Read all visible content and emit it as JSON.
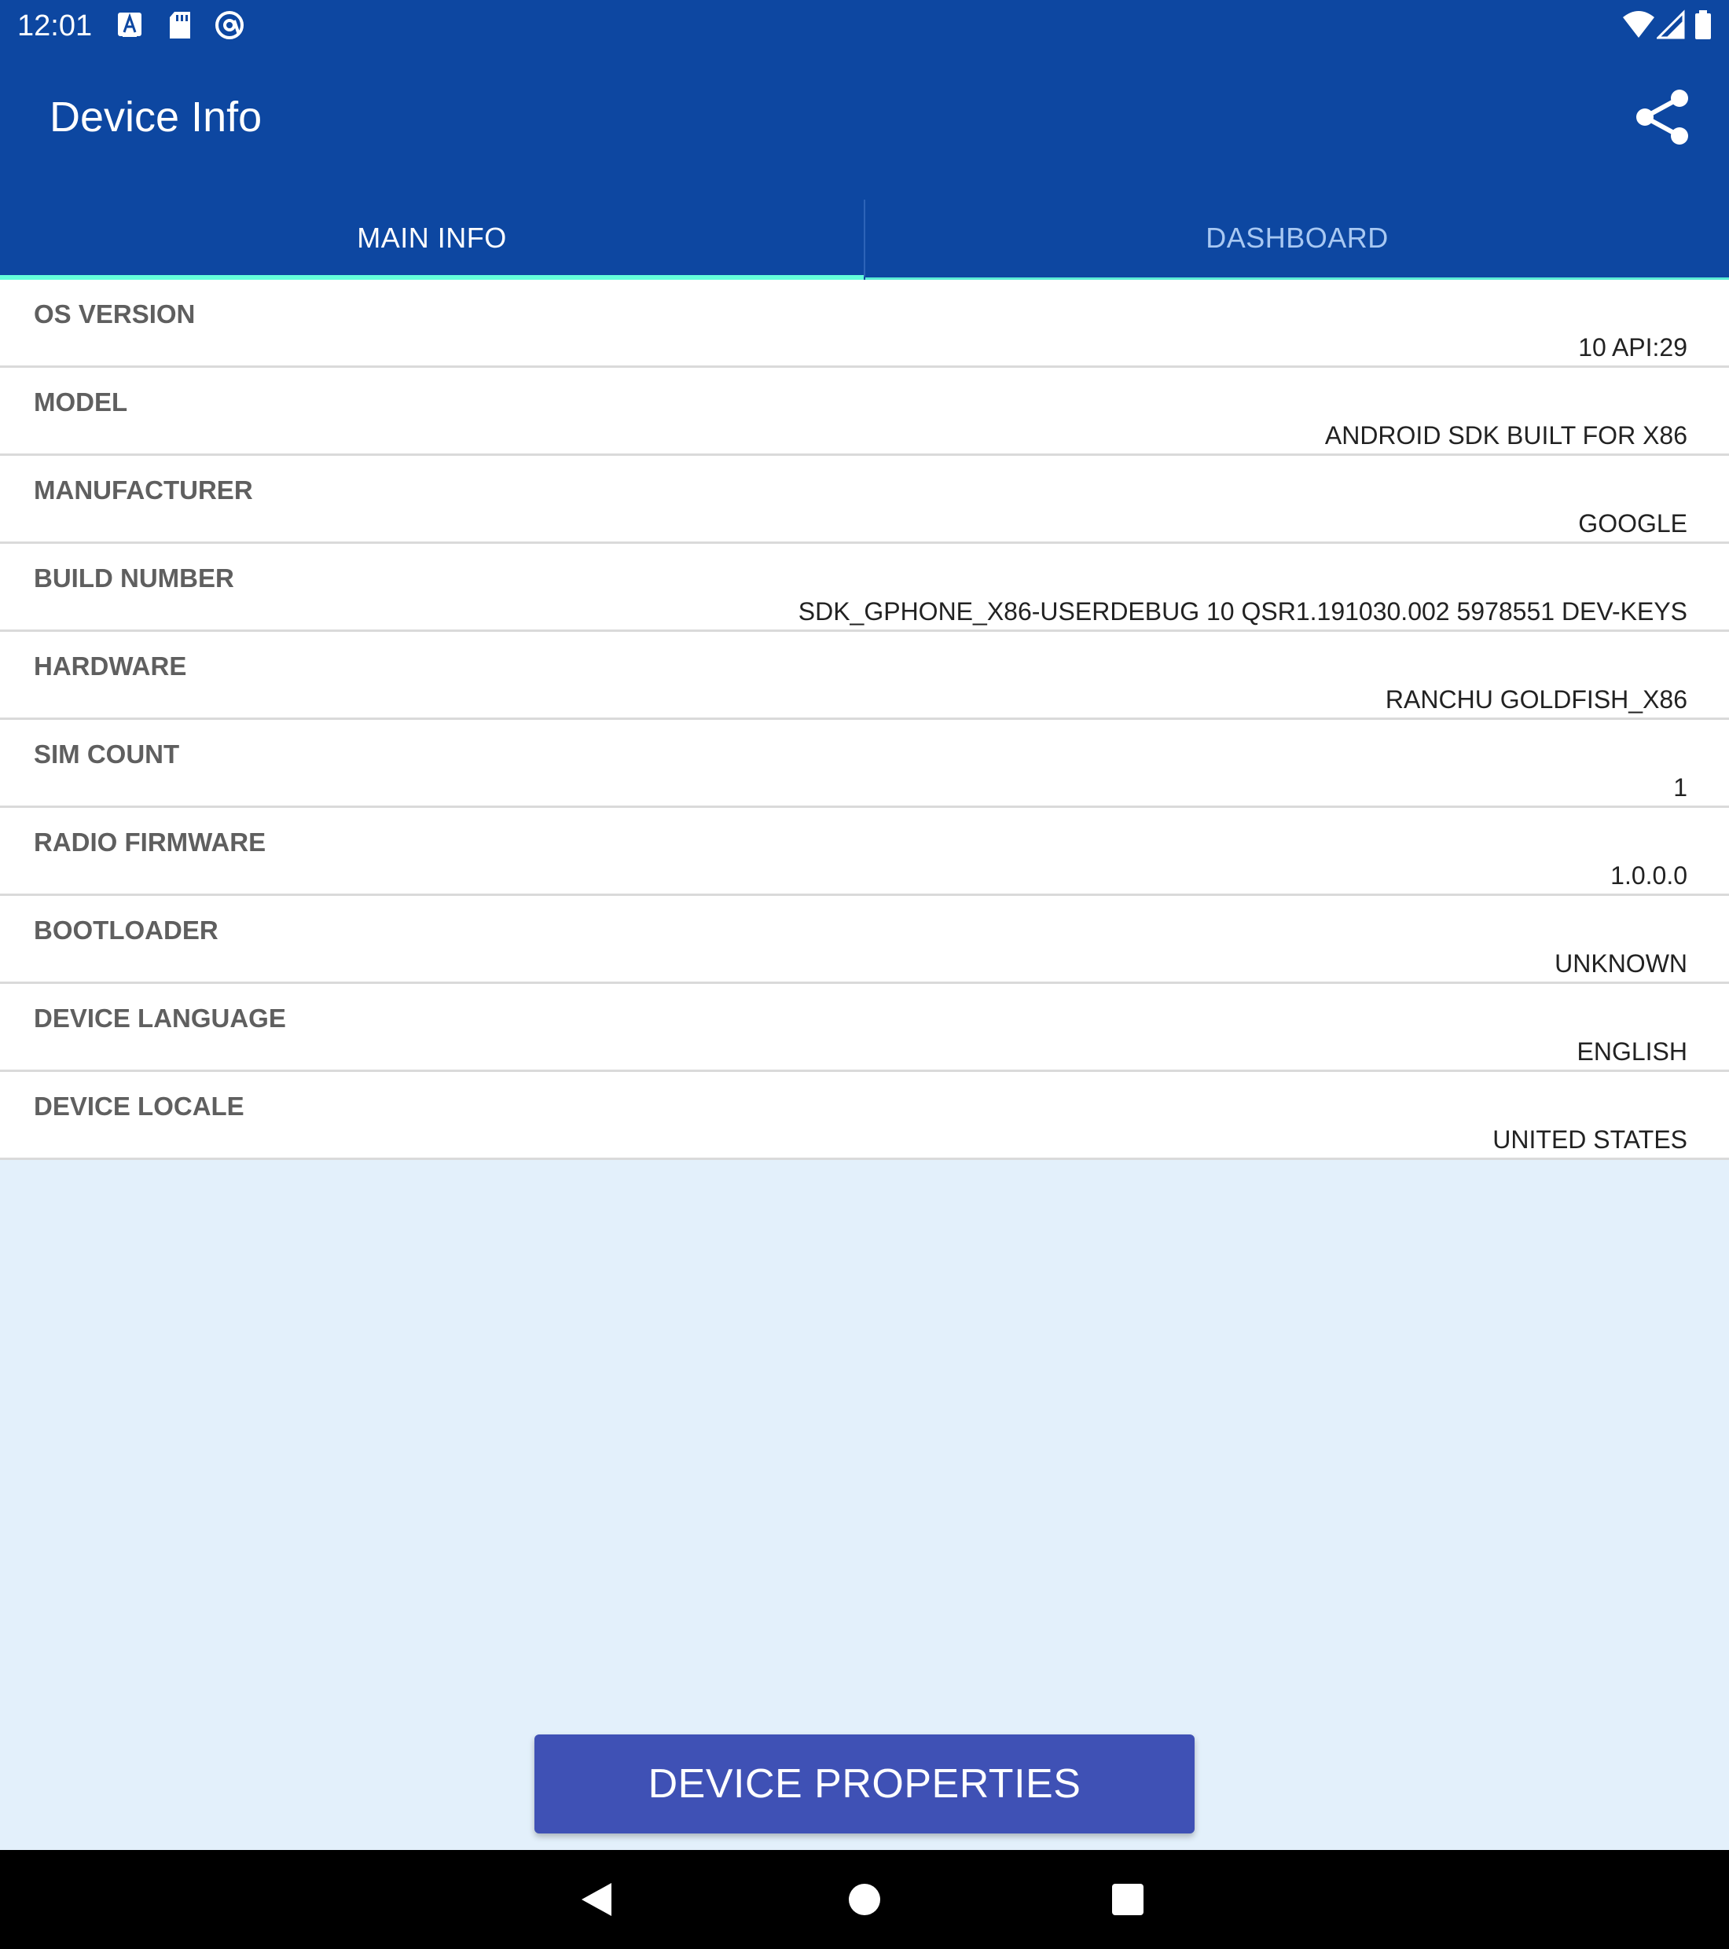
{
  "status_bar": {
    "time": "12:01",
    "left_icons": [
      "text-notification-icon",
      "sd-card-icon",
      "accessibility-icon"
    ],
    "right_icons": [
      "wifi-icon",
      "signal-icon",
      "battery-icon"
    ]
  },
  "app_bar": {
    "title": "Device Info",
    "share_icon": "share-icon"
  },
  "tabs": [
    {
      "label": "MAIN INFO",
      "selected": true
    },
    {
      "label": "DASHBOARD",
      "selected": false
    }
  ],
  "colors": {
    "primary": "#0d47a1",
    "tab_indicator": "#64ffda",
    "button": "#3f51b5",
    "background": "#e3f0fb"
  },
  "info": [
    {
      "label": "OS VERSION",
      "value": "10  API:29"
    },
    {
      "label": "MODEL",
      "value": "ANDROID SDK BUILT FOR X86"
    },
    {
      "label": "MANUFACTURER",
      "value": "GOOGLE"
    },
    {
      "label": "BUILD NUMBER",
      "value": "SDK_GPHONE_X86-USERDEBUG 10 QSR1.191030.002 5978551 DEV-KEYS"
    },
    {
      "label": "HARDWARE",
      "value": "RANCHU GOLDFISH_X86"
    },
    {
      "label": "SIM COUNT",
      "value": "1"
    },
    {
      "label": "RADIO FIRMWARE",
      "value": "1.0.0.0"
    },
    {
      "label": "BOOTLOADER",
      "value": "UNKNOWN"
    },
    {
      "label": "DEVICE LANGUAGE",
      "value": "ENGLISH"
    },
    {
      "label": "DEVICE LOCALE",
      "value": "UNITED STATES"
    }
  ],
  "actions": {
    "device_properties": "DEVICE PROPERTIES"
  },
  "nav_bar": {
    "icons": [
      "back-icon",
      "home-icon",
      "recents-icon"
    ]
  }
}
